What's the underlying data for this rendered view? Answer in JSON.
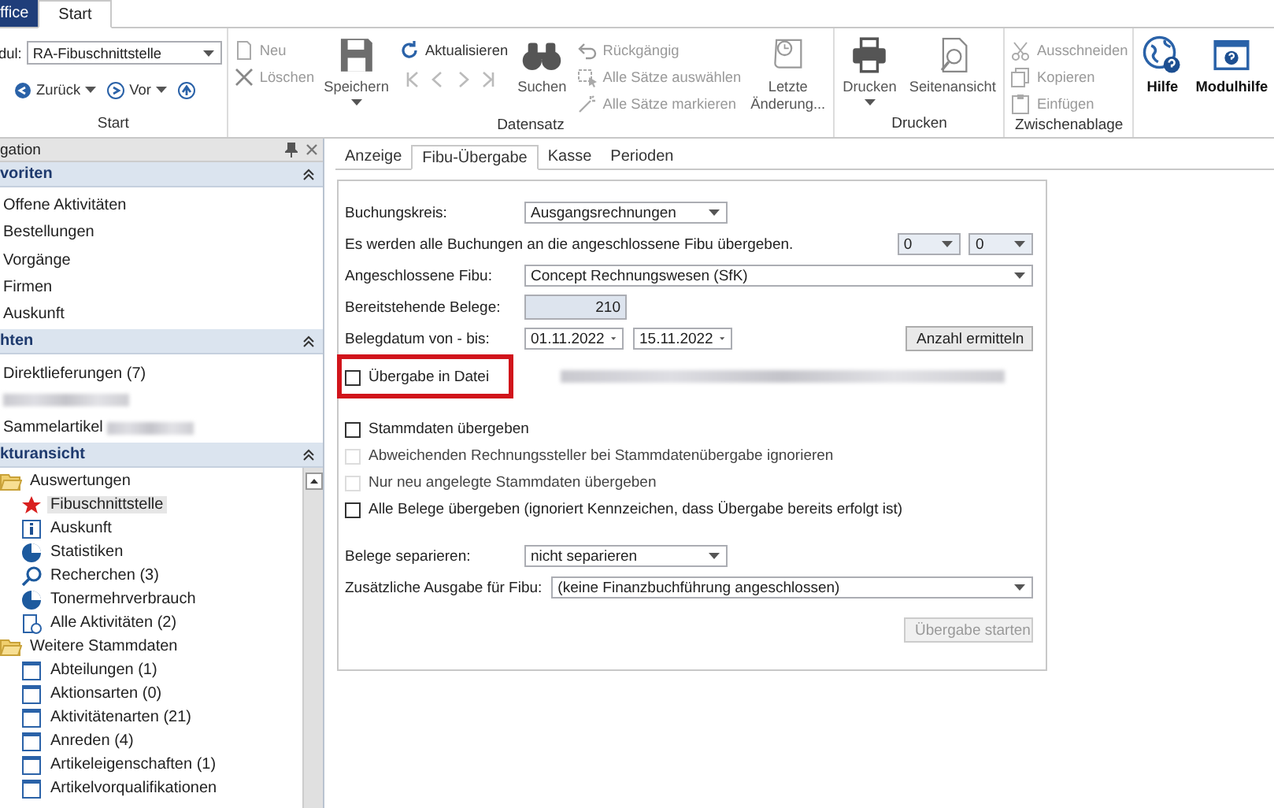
{
  "ribbon_tabs": [
    {
      "label": "ffice",
      "selected": false
    },
    {
      "label": "Start",
      "selected": true
    }
  ],
  "ribbon": {
    "groups": [
      {
        "label": "Start",
        "columns": [
          {
            "kind": "module",
            "label": "dul:",
            "value": "RA-Fibuschnittstelle",
            "back": "Zurück",
            "forward": "Vor"
          }
        ]
      },
      {
        "label": "Datensatz",
        "columns": [
          {
            "kind": "stack",
            "items": [
              {
                "kind": "button",
                "label": "Neu",
                "disabled": true
              },
              {
                "kind": "button",
                "label": "Löschen",
                "disabled": true
              }
            ]
          },
          {
            "kind": "large",
            "label": "Speichern",
            "disabled": false,
            "caret": true
          },
          {
            "kind": "stack",
            "items": [
              {
                "kind": "button",
                "label": "Aktualisieren",
                "disabled": false
              },
              {
                "kind": "record_nav",
                "disabled": true
              }
            ]
          },
          {
            "kind": "large",
            "label": "Suchen",
            "disabled": false,
            "caret": false
          },
          {
            "kind": "stack",
            "items": [
              {
                "kind": "button",
                "label": "Rückgängig",
                "disabled": true
              },
              {
                "kind": "button",
                "label": "Alle Sätze auswählen",
                "disabled": true
              },
              {
                "kind": "button",
                "label": "Alle Sätze markieren",
                "disabled": true
              }
            ]
          },
          {
            "kind": "large",
            "label": "Letzte Änderung...",
            "disabled": false,
            "caret": false
          }
        ]
      },
      {
        "label": "Drucken",
        "columns": [
          {
            "kind": "large",
            "label": "Drucken",
            "disabled": false,
            "caret": true
          },
          {
            "kind": "large",
            "label": "Seitenansicht",
            "disabled": false,
            "caret": false
          }
        ]
      },
      {
        "label": "Zwischenablage",
        "columns": [
          {
            "kind": "stack",
            "items": [
              {
                "kind": "button",
                "label": "Ausschneiden",
                "disabled": true
              },
              {
                "kind": "button",
                "label": "Kopieren",
                "disabled": true
              },
              {
                "kind": "button",
                "label": "Einfügen",
                "disabled": true
              }
            ]
          }
        ]
      },
      {
        "columns": [
          {
            "kind": "large",
            "label": "Hilfe",
            "disabled": false,
            "caret": false
          },
          {
            "kind": "large",
            "label": "Modulhilfe",
            "disabled": false,
            "caret": false
          }
        ]
      }
    ]
  },
  "navigation": {
    "title": "gation",
    "sections": [
      {
        "title": "voriten",
        "expanded": true,
        "items": [
          {
            "label": "Offene Aktivitäten"
          },
          {
            "label": "Bestellungen"
          },
          {
            "label": "Vorgänge"
          },
          {
            "label": "Firmen"
          },
          {
            "label": "Auskunft"
          }
        ]
      },
      {
        "title": "hten",
        "expanded": true,
        "items": [
          {
            "label": "Direktlieferungen (7)",
            "redacted": false
          },
          {
            "redacted": true
          },
          {
            "label": "Sammelartikel",
            "redacted": true
          }
        ]
      },
      {
        "title": "kturansicht",
        "expanded": true,
        "tree": [
          {
            "label": "Auswertungen",
            "expanded": true,
            "selected": false,
            "children": [
              {
                "label": "Fibuschnittstelle",
                "selected": true
              },
              {
                "label": "Auskunft",
                "selected": false
              },
              {
                "label": "Statistiken",
                "selected": false
              },
              {
                "label": "Recherchen (3)",
                "selected": false
              },
              {
                "label": "Tonermehrverbrauch",
                "selected": false
              },
              {
                "label": "Alle Aktivitäten (2)",
                "selected": false
              }
            ]
          },
          {
            "label": "Weitere Stammdaten",
            "expanded": true,
            "selected": false,
            "children": [
              {
                "label": "Abteilungen (1)",
                "selected": false
              },
              {
                "label": "Aktionsarten (0)",
                "selected": false
              },
              {
                "label": "Aktivitätenarten (21)",
                "selected": false
              },
              {
                "label": "Anreden (4)",
                "selected": false
              },
              {
                "label": "Artikeleigenschaften (1)",
                "selected": false
              },
              {
                "label": "Artikelvorqualifikationen",
                "selected": false
              }
            ]
          }
        ]
      }
    ]
  },
  "tabs": [
    {
      "label": "Anzeige",
      "selected": false
    },
    {
      "label": "Fibu-Übergabe",
      "selected": true
    },
    {
      "label": "Kasse",
      "selected": false
    },
    {
      "label": "Perioden",
      "selected": false
    }
  ],
  "form": [
    {
      "kind": "select",
      "label": "Buchungskreis:",
      "value": "Ausgangsrechnungen",
      "wide": false
    },
    {
      "kind": "info",
      "text": "Es werden alle Buchungen an die angeschlossene Fibu übergeben.",
      "selects": [
        "0",
        "0"
      ]
    },
    {
      "kind": "select",
      "label": "Angeschlossene Fibu:",
      "value": "Concept Rechnungswesen (SfK)",
      "wide": true
    },
    {
      "kind": "number",
      "label": "Bereitstehende Belege:",
      "value": "210"
    },
    {
      "kind": "daterange",
      "label": "Belegdatum von - bis:",
      "from": "01.11.2022",
      "to": "15.11.2022",
      "button": "Anzahl ermitteln"
    },
    {
      "kind": "checkbox",
      "label": "Übergabe in Datei",
      "checked": false,
      "disabled": false,
      "highlighted": true,
      "redacted": true
    },
    {
      "kind": "gap"
    },
    {
      "kind": "checkbox",
      "label": "Stammdaten übergeben",
      "checked": false,
      "disabled": false,
      "highlighted": false,
      "redacted": false
    },
    {
      "kind": "checkbox",
      "label": "Abweichenden Rechnungssteller bei Stammdatenübergabe ignorieren",
      "checked": false,
      "disabled": true,
      "highlighted": false,
      "redacted": false
    },
    {
      "kind": "checkbox",
      "label": "Nur neu angelegte Stammdaten übergeben",
      "checked": false,
      "disabled": true,
      "highlighted": false,
      "redacted": false
    },
    {
      "kind": "checkbox",
      "label": "Alle Belege übergeben (ignoriert Kennzeichen, dass Übergabe bereits erfolgt ist)",
      "checked": false,
      "disabled": false,
      "highlighted": false,
      "redacted": false
    },
    {
      "kind": "gap"
    },
    {
      "kind": "select",
      "label": "Belege separieren:",
      "value": "nicht separieren",
      "wide": false
    },
    {
      "kind": "select",
      "label": "Zusätzliche Ausgabe für Fibu:",
      "value": "(keine Finanzbuchführung angeschlossen)",
      "wide": true
    },
    {
      "kind": "action",
      "label": "Übergabe starten",
      "disabled": true
    }
  ]
}
